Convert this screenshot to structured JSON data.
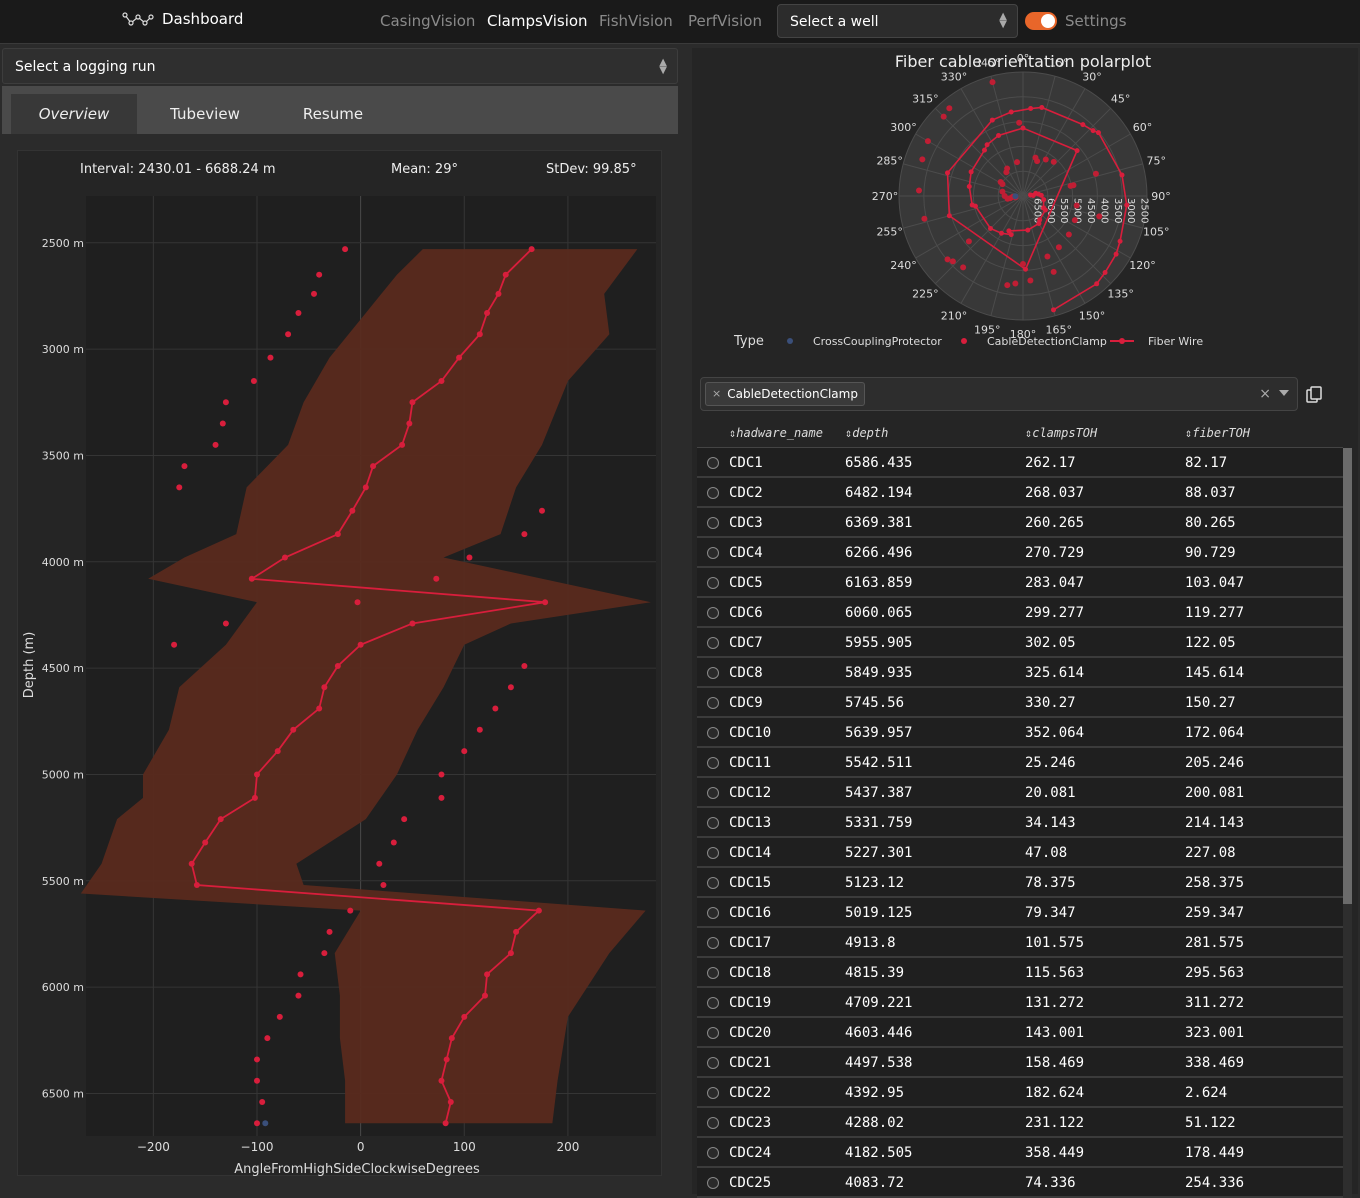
{
  "header": {
    "brand": "Dashboard",
    "nav": [
      "CasingVision",
      "ClampsVision",
      "FishVision",
      "PerfVision"
    ],
    "active_nav": "ClampsVision",
    "well_select": "Select a well",
    "settings_label": "Settings",
    "settings_toggle_on": true,
    "colors": {
      "accent": "#e8662a"
    }
  },
  "left": {
    "run_select": "Select a logging run",
    "tabs": [
      "Overview",
      "Tubeview",
      "Resume"
    ],
    "active_tab": "Overview",
    "stats": {
      "interval": "Interval: 2430.01 - 6688.24 m",
      "mean": "Mean: 29°",
      "stdev": "StDev: 99.85°"
    }
  },
  "chart_data": [
    {
      "type": "line",
      "xlabel": "AngleFromHighSideClockwiseDegrees",
      "ylabel": "Depth (m)",
      "xlim": [
        -265,
        285
      ],
      "ylim": [
        6700,
        2280
      ],
      "y_reversed": true,
      "xticks": [
        "−200",
        "−100",
        "0",
        "100",
        "200"
      ],
      "yticks": [
        "2500 m",
        "3000 m",
        "3500 m",
        "4000 m",
        "4500 m",
        "5000 m",
        "5500 m",
        "6000 m",
        "6500 m"
      ],
      "grid": true,
      "series": [
        {
          "type": "line",
          "color": "#d81e3c",
          "points": [
            [
              165,
              2530
            ],
            [
              140,
              2650
            ],
            [
              133,
              2740
            ],
            [
              122,
              2830
            ],
            [
              115,
              2930
            ],
            [
              95,
              3040
            ],
            [
              78,
              3150
            ],
            [
              50,
              3250
            ],
            [
              47,
              3350
            ],
            [
              40,
              3450
            ],
            [
              12,
              3550
            ],
            [
              5,
              3650
            ],
            [
              -8,
              3760
            ],
            [
              -22,
              3870
            ],
            [
              -73,
              3980
            ],
            [
              -105,
              4080
            ],
            [
              178,
              4190
            ],
            [
              50,
              4290
            ],
            [
              0,
              4390
            ],
            [
              -22,
              4490
            ],
            [
              -35,
              4590
            ],
            [
              -40,
              4690
            ],
            [
              -65,
              4790
            ],
            [
              -80,
              4890
            ],
            [
              -100,
              5000
            ],
            [
              -102,
              5110
            ],
            [
              -135,
              5210
            ],
            [
              -150,
              5320
            ],
            [
              -163,
              5420
            ],
            [
              -158,
              5520
            ],
            [
              172,
              5640
            ],
            [
              150,
              5740
            ],
            [
              145,
              5840
            ],
            [
              122,
              5940
            ],
            [
              120,
              6040
            ],
            [
              100,
              6140
            ],
            [
              88,
              6240
            ],
            [
              83,
              6340
            ],
            [
              78,
              6440
            ],
            [
              87,
              6540
            ],
            [
              82,
              6640
            ]
          ]
        },
        {
          "type": "band",
          "color": "#5a2a1e",
          "upper": [
            [
              267,
              2530
            ],
            [
              235,
              2740
            ],
            [
              240,
              2930
            ],
            [
              200,
              3150
            ],
            [
              175,
              3450
            ],
            [
              150,
              3650
            ],
            [
              135,
              3870
            ],
            [
              80,
              3980
            ],
            [
              280,
              4190
            ],
            [
              145,
              4290
            ],
            [
              100,
              4390
            ],
            [
              80,
              4590
            ],
            [
              55,
              4790
            ],
            [
              35,
              5000
            ],
            [
              5,
              5210
            ],
            [
              -62,
              5420
            ],
            [
              -55,
              5520
            ],
            [
              275,
              5640
            ],
            [
              240,
              5840
            ],
            [
              200,
              6140
            ],
            [
              190,
              6440
            ],
            [
              185,
              6640
            ]
          ],
          "lower": [
            [
              -190,
              6640
            ],
            [
              -15,
              6640
            ],
            [
              -15,
              6440
            ],
            [
              -20,
              6240
            ],
            [
              -20,
              6040
            ],
            [
              -25,
              5840
            ],
            [
              0,
              5640
            ],
            [
              -270,
              5560
            ],
            [
              -250,
              5420
            ],
            [
              -235,
              5210
            ],
            [
              -210,
              5110
            ],
            [
              -210,
              5000
            ],
            [
              -185,
              4790
            ],
            [
              -175,
              4590
            ],
            [
              -130,
              4390
            ],
            [
              -100,
              4190
            ],
            [
              -205,
              4080
            ],
            [
              -170,
              3980
            ],
            [
              -120,
              3870
            ],
            [
              -110,
              3650
            ],
            [
              -70,
              3450
            ],
            [
              -55,
              3250
            ],
            [
              -30,
              3040
            ],
            [
              5,
              2830
            ],
            [
              35,
              2650
            ],
            [
              60,
              2530
            ]
          ]
        },
        {
          "type": "scatter",
          "color": "#d81e3c",
          "points": [
            [
              -15,
              2530
            ],
            [
              -40,
              2650
            ],
            [
              -45,
              2740
            ],
            [
              -60,
              2830
            ],
            [
              -70,
              2930
            ],
            [
              -87,
              3040
            ],
            [
              -103,
              3150
            ],
            [
              -130,
              3250
            ],
            [
              -133,
              3350
            ],
            [
              -140,
              3450
            ],
            [
              -170,
              3550
            ],
            [
              -175,
              3650
            ],
            [
              175,
              3760
            ],
            [
              158,
              3870
            ],
            [
              105,
              3980
            ],
            [
              73,
              4080
            ],
            [
              -3,
              4190
            ],
            [
              -130,
              4290
            ],
            [
              -180,
              4390
            ],
            [
              158,
              4490
            ],
            [
              145,
              4590
            ],
            [
              130,
              4690
            ],
            [
              115,
              4790
            ],
            [
              100,
              4890
            ],
            [
              78,
              5000
            ],
            [
              78,
              5110
            ],
            [
              42,
              5210
            ],
            [
              32,
              5320
            ],
            [
              18,
              5420
            ],
            [
              22,
              5520
            ],
            [
              -10,
              5640
            ],
            [
              -30,
              5740
            ],
            [
              -35,
              5840
            ],
            [
              -58,
              5940
            ],
            [
              -60,
              6040
            ],
            [
              -78,
              6140
            ],
            [
              -90,
              6240
            ],
            [
              -100,
              6340
            ],
            [
              -100,
              6440
            ],
            [
              -95,
              6540
            ],
            [
              -100,
              6640
            ]
          ]
        },
        {
          "type": "scatter",
          "color": "#3a4f7a",
          "points": [
            [
              -92,
              6640
            ]
          ]
        }
      ]
    },
    {
      "type": "polar",
      "title": "Fiber cable orientation polarplot",
      "angular_ticks": [
        "0°",
        "15°",
        "30°",
        "45°",
        "60°",
        "75°",
        "90°",
        "105°",
        "120°",
        "135°",
        "150°",
        "165°",
        "180°",
        "195°",
        "210°",
        "225°",
        "240°",
        "255°",
        "270°",
        "285°",
        "300°",
        "315°",
        "330°",
        "345°"
      ],
      "radial_ticks": [
        "2500",
        "3000",
        "3500",
        "4000",
        "4500",
        "5000",
        "5500",
        "6000",
        "6500"
      ],
      "radial_range": [
        2300,
        6700
      ],
      "legend": {
        "title": "Type",
        "items": [
          {
            "name": "CrossCouplingProtector",
            "color": "#3a4f7a",
            "style": "dot"
          },
          {
            "name": "CableDetectionClamp",
            "color": "#d81e3c",
            "style": "dot"
          },
          {
            "name": "Fiber Wire",
            "color": "#d81e3c",
            "style": "line"
          }
        ]
      },
      "fiber_points": [
        [
          165,
          2530
        ],
        [
          140,
          2650
        ],
        [
          133,
          2740
        ],
        [
          122,
          2830
        ],
        [
          115,
          2930
        ],
        [
          95,
          3040
        ],
        [
          78,
          3150
        ],
        [
          50,
          3250
        ],
        [
          47,
          3350
        ],
        [
          40,
          3450
        ],
        [
          12,
          3550
        ],
        [
          5,
          3650
        ],
        [
          352,
          3760
        ],
        [
          338,
          3870
        ],
        [
          287,
          3980
        ],
        [
          255,
          4080
        ],
        [
          178,
          4190
        ],
        [
          50,
          4290
        ],
        [
          0,
          4390
        ],
        [
          338,
          4490
        ],
        [
          325,
          4590
        ],
        [
          320,
          4690
        ],
        [
          295,
          4790
        ],
        [
          280,
          4890
        ],
        [
          260,
          5000
        ],
        [
          258,
          5110
        ],
        [
          225,
          5210
        ],
        [
          210,
          5320
        ],
        [
          197,
          5420
        ],
        [
          202,
          5520
        ],
        [
          172,
          5640
        ],
        [
          150,
          5740
        ],
        [
          145,
          5840
        ],
        [
          122,
          5940
        ],
        [
          120,
          6040
        ],
        [
          100,
          6140
        ],
        [
          88,
          6240
        ],
        [
          83,
          6340
        ],
        [
          78,
          6440
        ],
        [
          87,
          6540
        ],
        [
          82,
          6640
        ]
      ],
      "clamp_points": [
        [
          345,
          2530
        ],
        [
          320,
          2650
        ],
        [
          315,
          2740
        ],
        [
          300,
          2830
        ],
        [
          290,
          2930
        ],
        [
          273,
          3040
        ],
        [
          257,
          3150
        ],
        [
          230,
          3250
        ],
        [
          227,
          3350
        ],
        [
          220,
          3450
        ],
        [
          190,
          3550
        ],
        [
          185,
          3650
        ],
        [
          175,
          3760
        ],
        [
          158,
          3870
        ],
        [
          105,
          3980
        ],
        [
          73,
          4080
        ],
        [
          357,
          4190
        ],
        [
          230,
          4290
        ],
        [
          180,
          4390
        ],
        [
          158,
          4490
        ],
        [
          145,
          4590
        ],
        [
          130,
          4690
        ],
        [
          115,
          4790
        ],
        [
          100,
          4890
        ],
        [
          78,
          5000
        ],
        [
          78,
          5110
        ],
        [
          42,
          5210
        ],
        [
          32,
          5320
        ],
        [
          18,
          5420
        ],
        [
          22,
          5520
        ],
        [
          350,
          5640
        ],
        [
          330,
          5740
        ],
        [
          325,
          5840
        ],
        [
          302,
          5940
        ],
        [
          300,
          6040
        ],
        [
          282,
          6140
        ],
        [
          270,
          6240
        ],
        [
          260,
          6340
        ],
        [
          260,
          6440
        ],
        [
          265,
          6540
        ],
        [
          260,
          6640
        ]
      ],
      "protector_points": [
        [
          268,
          6640
        ]
      ]
    }
  ],
  "filter": {
    "chip": "CableDetectionClamp"
  },
  "table": {
    "columns": [
      "hadware_name",
      "depth",
      "clampsTOH",
      "fiberTOH"
    ],
    "rows": [
      [
        "CDC1",
        "6586.435",
        "262.17",
        "82.17"
      ],
      [
        "CDC2",
        "6482.194",
        "268.037",
        "88.037"
      ],
      [
        "CDC3",
        "6369.381",
        "260.265",
        "80.265"
      ],
      [
        "CDC4",
        "6266.496",
        "270.729",
        "90.729"
      ],
      [
        "CDC5",
        "6163.859",
        "283.047",
        "103.047"
      ],
      [
        "CDC6",
        "6060.065",
        "299.277",
        "119.277"
      ],
      [
        "CDC7",
        "5955.905",
        "302.05",
        "122.05"
      ],
      [
        "CDC8",
        "5849.935",
        "325.614",
        "145.614"
      ],
      [
        "CDC9",
        "5745.56",
        "330.27",
        "150.27"
      ],
      [
        "CDC10",
        "5639.957",
        "352.064",
        "172.064"
      ],
      [
        "CDC11",
        "5542.511",
        "25.246",
        "205.246"
      ],
      [
        "CDC12",
        "5437.387",
        "20.081",
        "200.081"
      ],
      [
        "CDC13",
        "5331.759",
        "34.143",
        "214.143"
      ],
      [
        "CDC14",
        "5227.301",
        "47.08",
        "227.08"
      ],
      [
        "CDC15",
        "5123.12",
        "78.375",
        "258.375"
      ],
      [
        "CDC16",
        "5019.125",
        "79.347",
        "259.347"
      ],
      [
        "CDC17",
        "4913.8",
        "101.575",
        "281.575"
      ],
      [
        "CDC18",
        "4815.39",
        "115.563",
        "295.563"
      ],
      [
        "CDC19",
        "4709.221",
        "131.272",
        "311.272"
      ],
      [
        "CDC20",
        "4603.446",
        "143.001",
        "323.001"
      ],
      [
        "CDC21",
        "4497.538",
        "158.469",
        "338.469"
      ],
      [
        "CDC22",
        "4392.95",
        "182.624",
        "2.624"
      ],
      [
        "CDC23",
        "4288.02",
        "231.122",
        "51.122"
      ],
      [
        "CDC24",
        "4182.505",
        "358.449",
        "178.449"
      ],
      [
        "CDC25",
        "4083.72",
        "74.336",
        "254.336"
      ]
    ]
  }
}
